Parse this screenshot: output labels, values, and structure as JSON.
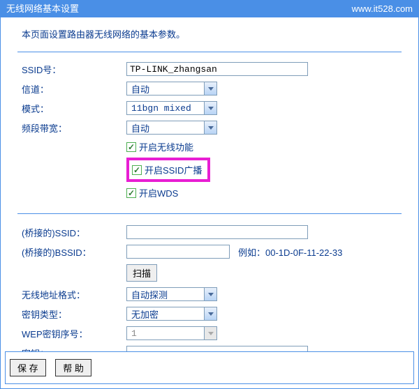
{
  "titlebar": {
    "title": "无线网络基本设置",
    "url": "www.it528.com"
  },
  "description": "本页面设置路由器无线网络的基本参数。",
  "fields": {
    "ssid": {
      "label": "SSID号：",
      "value": "TP-LINK_zhangsan"
    },
    "channel": {
      "label": "信道：",
      "value": "自动"
    },
    "mode": {
      "label": "模式：",
      "value": "11bgn mixed"
    },
    "bandwidth": {
      "label": "频段带宽：",
      "value": "自动"
    }
  },
  "checkboxes": {
    "wireless": {
      "label": "开启无线功能",
      "checked": true
    },
    "ssid_broadcast": {
      "label": "开启SSID广播",
      "checked": true
    },
    "wds": {
      "label": "开启WDS",
      "checked": true
    }
  },
  "bridge": {
    "ssid": {
      "label": "(桥接的)SSID：",
      "value": ""
    },
    "bssid": {
      "label": "(桥接的)BSSID：",
      "value": "",
      "hint": "例如：00-1D-0F-11-22-33"
    },
    "scan": "扫描",
    "addr_format": {
      "label": "无线地址格式：",
      "value": "自动探测"
    },
    "key_type": {
      "label": "密钥类型：",
      "value": "无加密"
    },
    "wep_index": {
      "label": "WEP密钥序号：",
      "value": "1"
    },
    "key": {
      "label": "密钥：",
      "value": ""
    }
  },
  "footer": {
    "save": "保 存",
    "help": "帮 助"
  }
}
